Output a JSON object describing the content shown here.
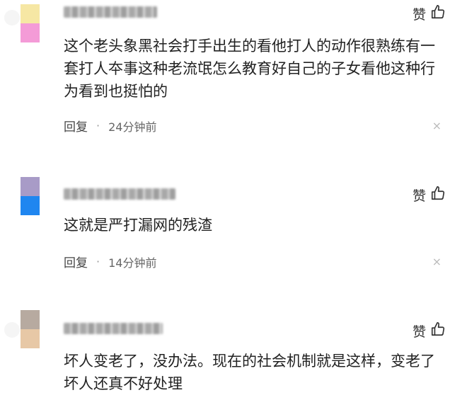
{
  "comments": [
    {
      "username": "",
      "like_label": "赞",
      "text": "这个老头象黑社会打手出生的看他打人的动作很熟练有一套打人夲事这种老流氓怎么教育好自己的子女看他这种行为看到也挺怕的",
      "reply_label": "回复",
      "separator": "·",
      "time": "24分钟前",
      "close": "×",
      "avatar_colors": [
        "#f6e7a4",
        "#f49bd7"
      ]
    },
    {
      "username": "",
      "like_label": "赞",
      "text": "这就是严打漏网的残渣",
      "reply_label": "回复",
      "separator": "·",
      "time": "14分钟前",
      "close": "×",
      "avatar_colors": [
        "#a89bc7",
        "#1f86f0"
      ]
    },
    {
      "username": "",
      "like_label": "赞",
      "text": "坏人变老了，没办法。现在的社会机制就是这样，变老了坏人还真不好处理",
      "reply_label": "",
      "separator": "",
      "time": "",
      "close": "",
      "avatar_colors": [
        "#b7aaa0",
        "#e7c8a6"
      ]
    }
  ],
  "icons": {
    "like": "thumbs-up-icon",
    "close": "close-icon"
  },
  "colors": {
    "text": "#222222",
    "meta": "#666666",
    "close": "#bbbbbb"
  }
}
